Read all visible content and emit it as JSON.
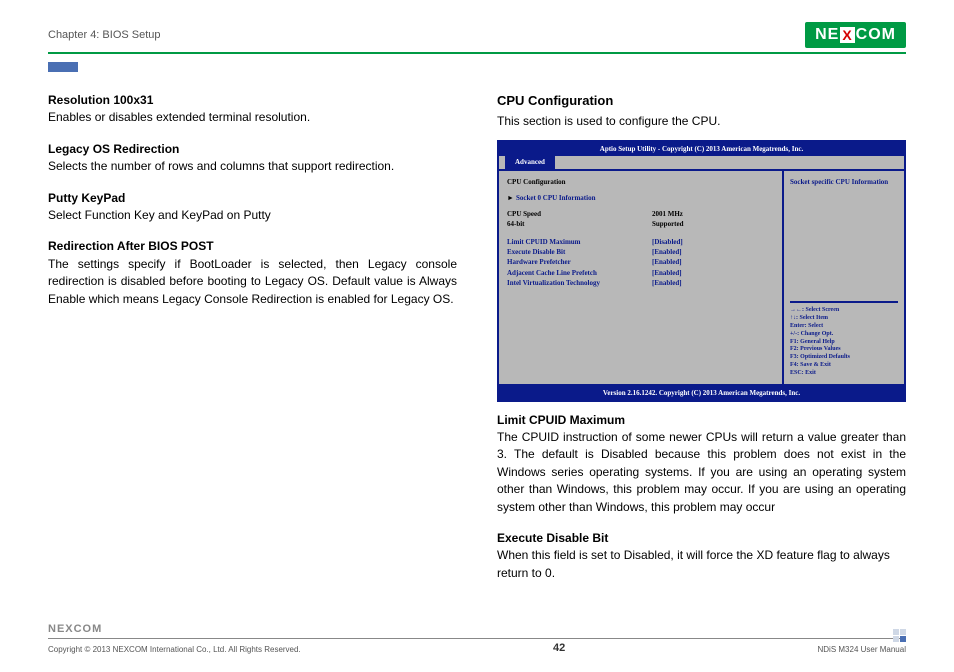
{
  "header": {
    "chapter": "Chapter 4: BIOS Setup",
    "logo_left": "NE",
    "logo_x": "X",
    "logo_right": "COM"
  },
  "left": {
    "h1": "Resolution 100x31",
    "p1": "Enables or disables extended terminal resolution.",
    "h2": "Legacy OS Redirection",
    "p2": "Selects the number of rows and columns that support redirection.",
    "h3": "Putty KeyPad",
    "p3": "Select Function Key and KeyPad on Putty",
    "h4": "Redirection After BIOS POST",
    "p4": "The settings specify if BootLoader is selected, then Legacy console redirection is disabled before booting to Legacy OS. Default value is Always Enable which means Legacy Console Redirection is enabled for Legacy OS."
  },
  "right": {
    "h1": "CPU Configuration",
    "p1": "This section is used to configure the CPU.",
    "h2": "Limit CPUID Maximum",
    "p2": "The CPUID instruction of some newer CPUs will return a value greater than 3. The default is Disabled because this problem does not exist in the Windows series operating systems. If you are using an operating system other than Windows, this problem may occur.  If you are using an operating system other than Windows, this problem may occur",
    "h3": "Execute Disable Bit",
    "p3": "When this field is set to Disabled, it will force the XD feature flag to always return to 0."
  },
  "bios": {
    "title": "Aptio Setup Utility - Copyright (C) 2013 American Megatrends, Inc.",
    "tab": "Advanced",
    "section": "CPU Configuration",
    "socket": "Socket 0 CPU Information",
    "arrow": "►",
    "rows_info": [
      {
        "label": "CPU Speed",
        "val": "2001 MHz"
      },
      {
        "label": "64-bit",
        "val": "Supported"
      }
    ],
    "rows_opts": [
      {
        "label": "Limit CPUID Maximum",
        "val": "[Disabled]"
      },
      {
        "label": "Execute Disable Bit",
        "val": "[Enabled]"
      },
      {
        "label": "Hardware Prefetcher",
        "val": "[Enabled]"
      },
      {
        "label": "Adjacent Cache Line Prefetch",
        "val": "[Enabled]"
      },
      {
        "label": "Intel Virtualization Technology",
        "val": "[Enabled]"
      }
    ],
    "side_info": "Socket specific CPU Information",
    "help": [
      "→←: Select Screen",
      "↑↓: Select Item",
      "Enter: Select",
      "+/-: Change Opt.",
      "F1: General Help",
      "F2: Previous Values",
      "F3: Optimized Defaults",
      "F4: Save & Exit",
      "ESC: Exit"
    ],
    "footer": "Version 2.16.1242. Copyright (C) 2013 American Megatrends, Inc."
  },
  "footer": {
    "logo": "NEXCOM",
    "copyright": "Copyright © 2013 NEXCOM International Co., Ltd. All Rights Reserved.",
    "page": "42",
    "manual": "NDiS M324 User Manual"
  }
}
